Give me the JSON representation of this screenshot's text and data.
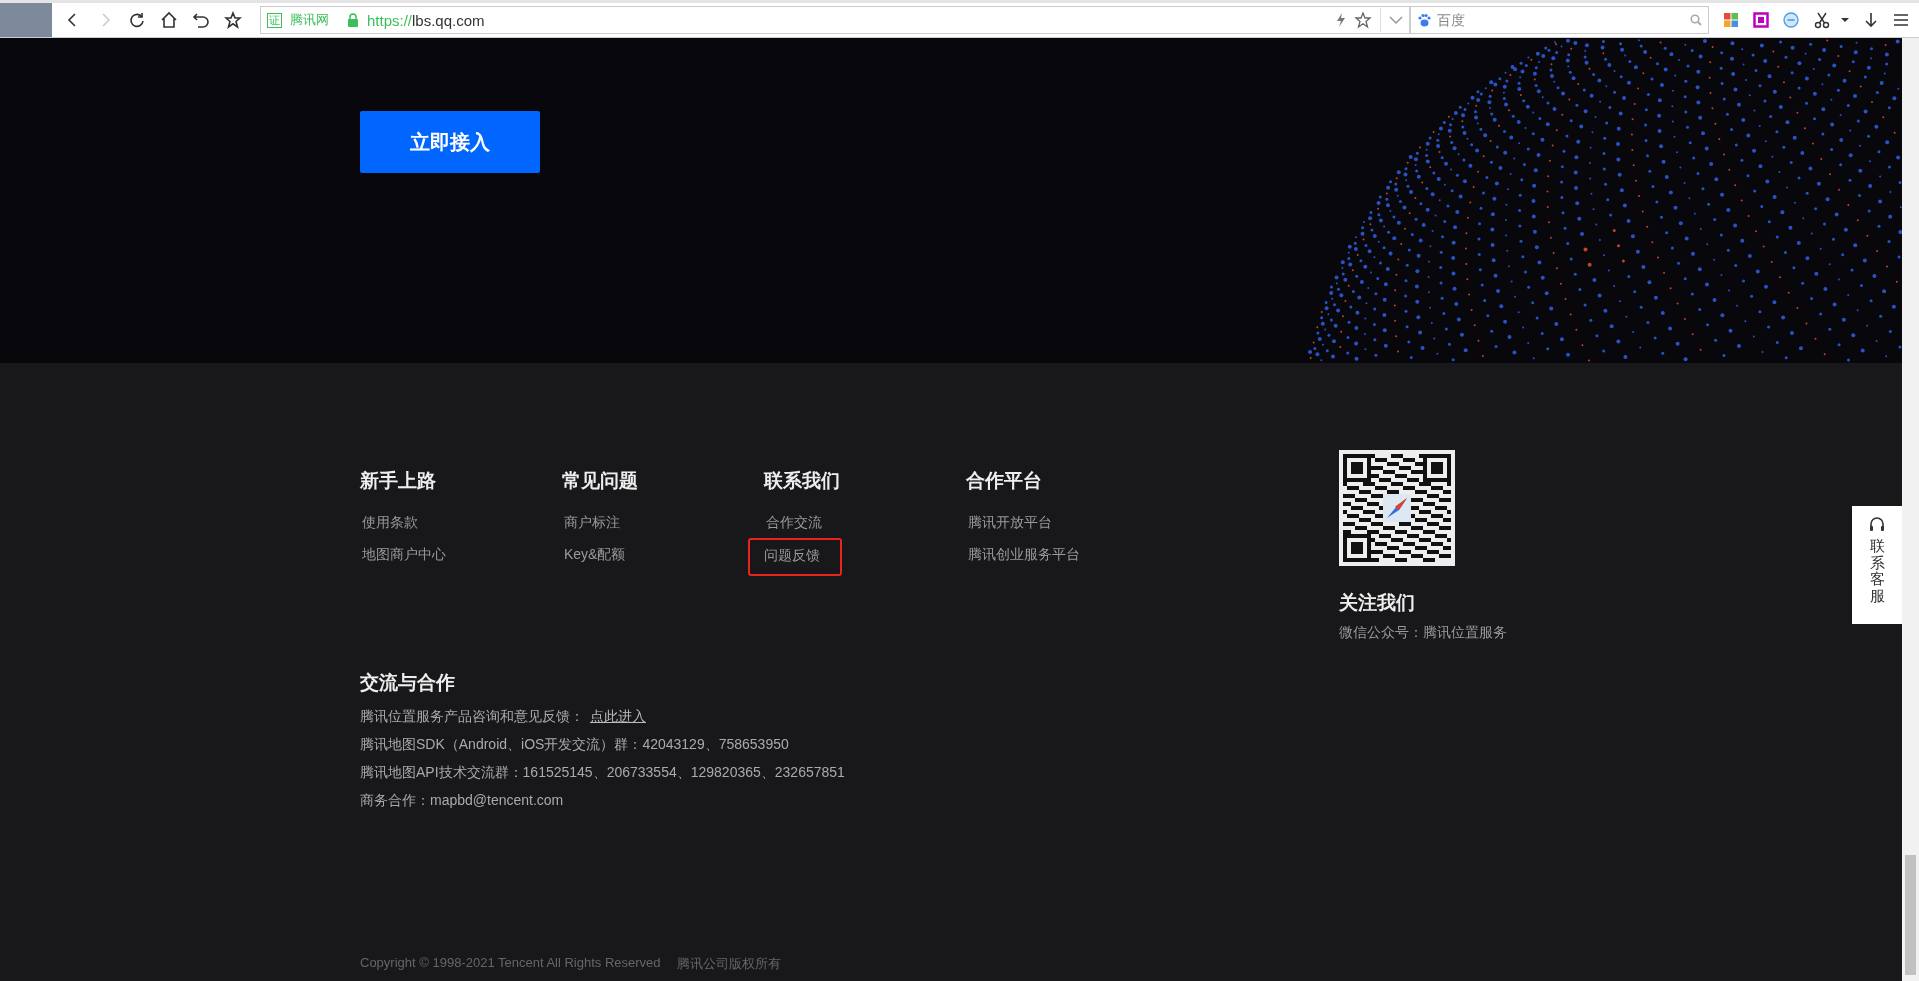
{
  "browser": {
    "nav": [
      {
        "kind": "back",
        "disabled": false
      },
      {
        "kind": "forward",
        "disabled": true
      },
      {
        "kind": "reload",
        "disabled": false
      },
      {
        "kind": "home",
        "disabled": false
      },
      {
        "kind": "undo",
        "disabled": false
      },
      {
        "kind": "star",
        "disabled": false
      }
    ],
    "address": {
      "cert_mark": "证",
      "site_badge": "腾讯网",
      "scheme": "https://",
      "host": "lbs.qq.com"
    },
    "search": {
      "placeholder": "百度"
    }
  },
  "hero": {
    "button": "立即接入"
  },
  "footer": {
    "columns": [
      {
        "title": "新手上路",
        "links": [
          {
            "label": "使用条款",
            "highlighted": false
          },
          {
            "label": "地图商户中心",
            "highlighted": false
          }
        ]
      },
      {
        "title": "常见问题",
        "links": [
          {
            "label": "商户标注",
            "highlighted": false
          },
          {
            "label": "Key&配额",
            "highlighted": false
          }
        ]
      },
      {
        "title": "联系我们",
        "links": [
          {
            "label": "合作交流",
            "highlighted": false
          },
          {
            "label": "问题反馈",
            "highlighted": true
          }
        ]
      },
      {
        "title": "合作平台",
        "links": [
          {
            "label": "腾讯开放平台",
            "highlighted": false
          },
          {
            "label": "腾讯创业服务平台",
            "highlighted": false
          }
        ]
      }
    ],
    "follow": {
      "title": "关注我们",
      "text": "微信公众号：腾讯位置服务"
    },
    "contact": {
      "title": "交流与合作",
      "lines": [
        {
          "text": "腾讯位置服务产品咨询和意见反馈：",
          "link": "点此进入"
        },
        {
          "text": "腾讯地图SDK（Android、iOS开发交流）群：42043129、758653950"
        },
        {
          "text": "腾讯地图API技术交流群：161525145、206733554、129820365、232657851"
        },
        {
          "text": "商务合作：mapbd@tencent.com"
        }
      ]
    },
    "copyright": [
      "Copyright © 1998-2021 Tencent All Rights Reserved",
      "腾讯公司版权所有"
    ]
  },
  "side_widget": {
    "label": "联系客服"
  }
}
